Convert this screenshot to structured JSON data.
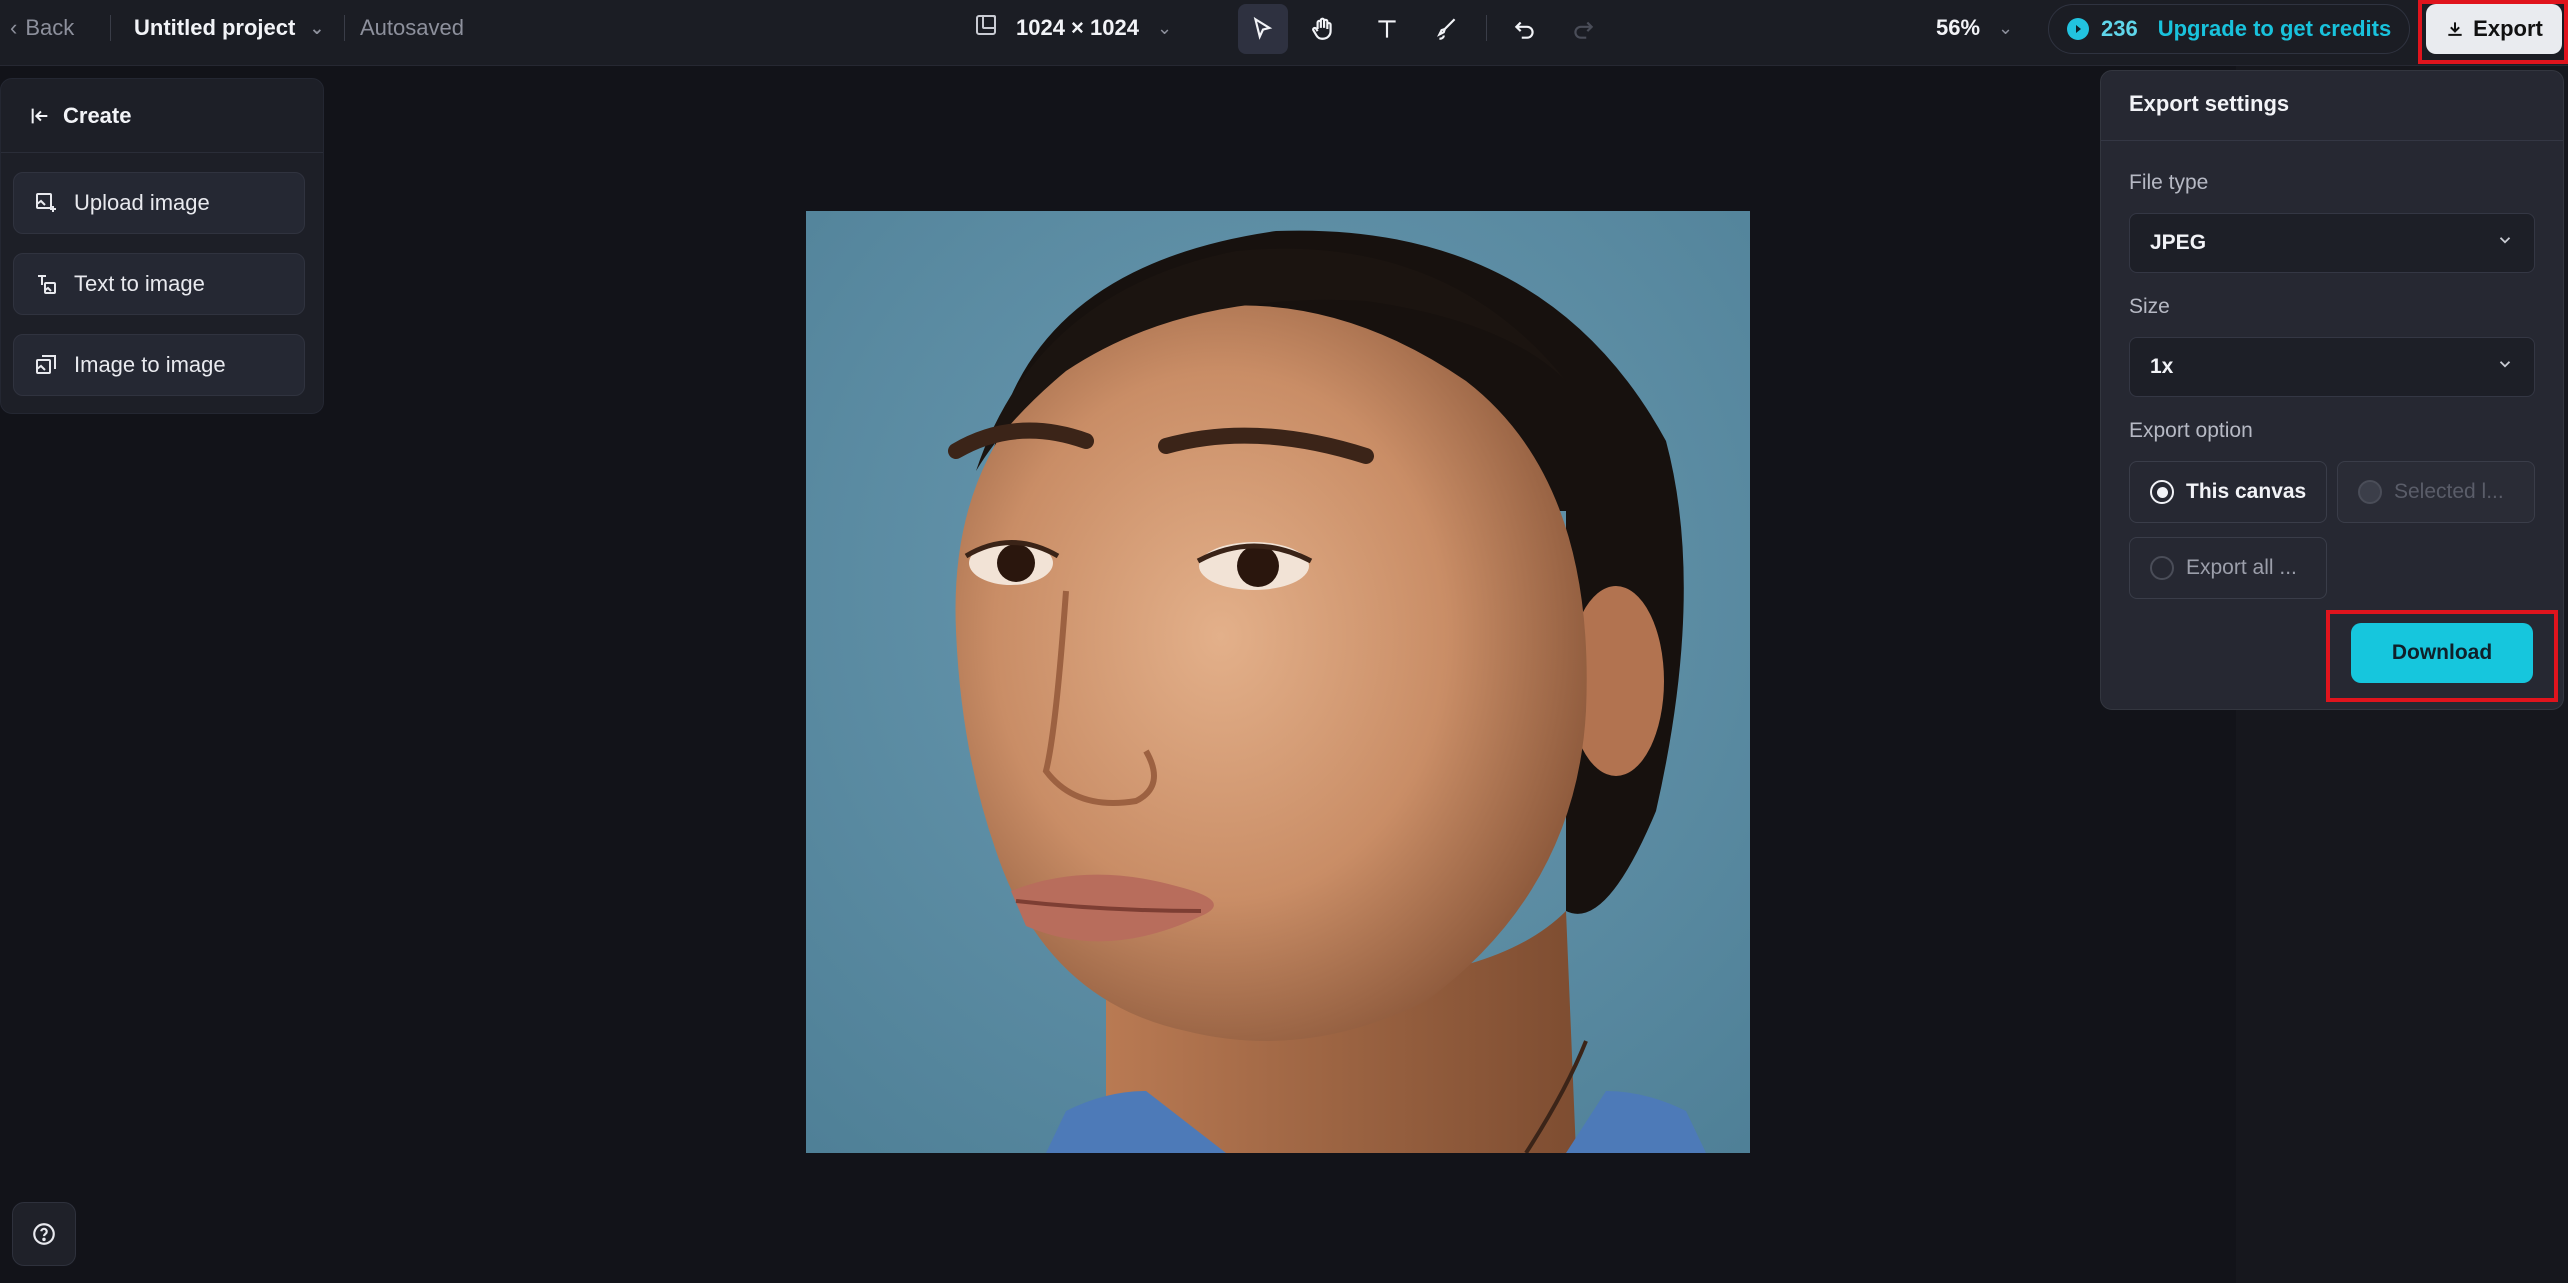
{
  "topbar": {
    "back_label": "Back",
    "project_name": "Untitled project",
    "autosave_status": "Autosaved",
    "canvas_size": "1024 × 1024",
    "zoom_level": "56%",
    "credits_count": "236",
    "upgrade_label": "Upgrade to get credits",
    "export_label": "Export",
    "tools": [
      "select-tool",
      "hand-tool",
      "text-tool",
      "brush-tool",
      "undo",
      "redo"
    ]
  },
  "left_panel": {
    "header_label": "Create",
    "buttons": [
      {
        "label": "Upload image",
        "icon": "upload-image-icon"
      },
      {
        "label": "Text to image",
        "icon": "text-to-image-icon"
      },
      {
        "label": "Image to image",
        "icon": "image-to-image-icon"
      }
    ]
  },
  "export_settings": {
    "title": "Export settings",
    "file_type_label": "File type",
    "file_type_value": "JPEG",
    "size_label": "Size",
    "size_value": "1x",
    "export_option_label": "Export option",
    "options": [
      {
        "label": "This canvas",
        "selected": true,
        "disabled": false
      },
      {
        "label": "Selected l...",
        "selected": false,
        "disabled": true
      },
      {
        "label": "Export all ...",
        "selected": false,
        "disabled": false
      }
    ],
    "download_label": "Download"
  },
  "colors": {
    "accent": "#16c6dd",
    "highlight_box": "#e0141d",
    "background": "#121319"
  }
}
